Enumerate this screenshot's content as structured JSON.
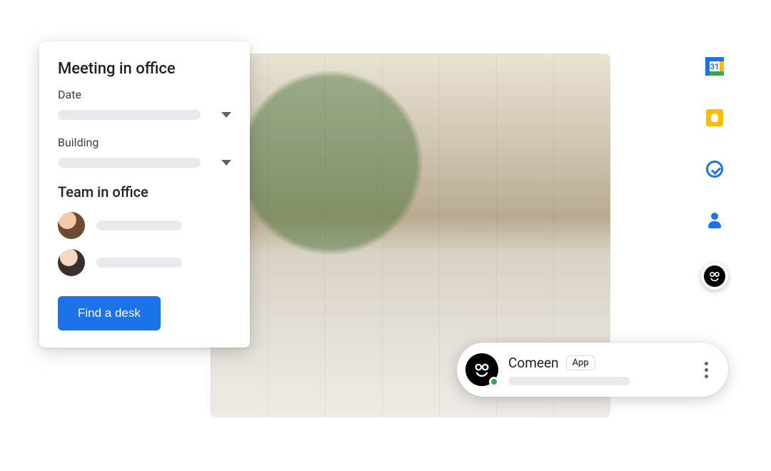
{
  "card": {
    "title": "Meeting in office",
    "date_label": "Date",
    "building_label": "Building",
    "team_heading": "Team in office",
    "cta": "Find a desk"
  },
  "chip": {
    "name": "Comeen",
    "badge": "App"
  },
  "sidebar": {
    "calendar_day": "31"
  },
  "icons": {
    "calendar": "calendar-icon",
    "keep": "keep-icon",
    "tasks": "tasks-icon",
    "contacts": "contacts-icon",
    "comeen": "comeen-app-icon"
  },
  "colors": {
    "primary": "#1a73e8",
    "green": "#34a853",
    "yellow": "#fbbc04",
    "placeholder": "#e8eaed"
  }
}
